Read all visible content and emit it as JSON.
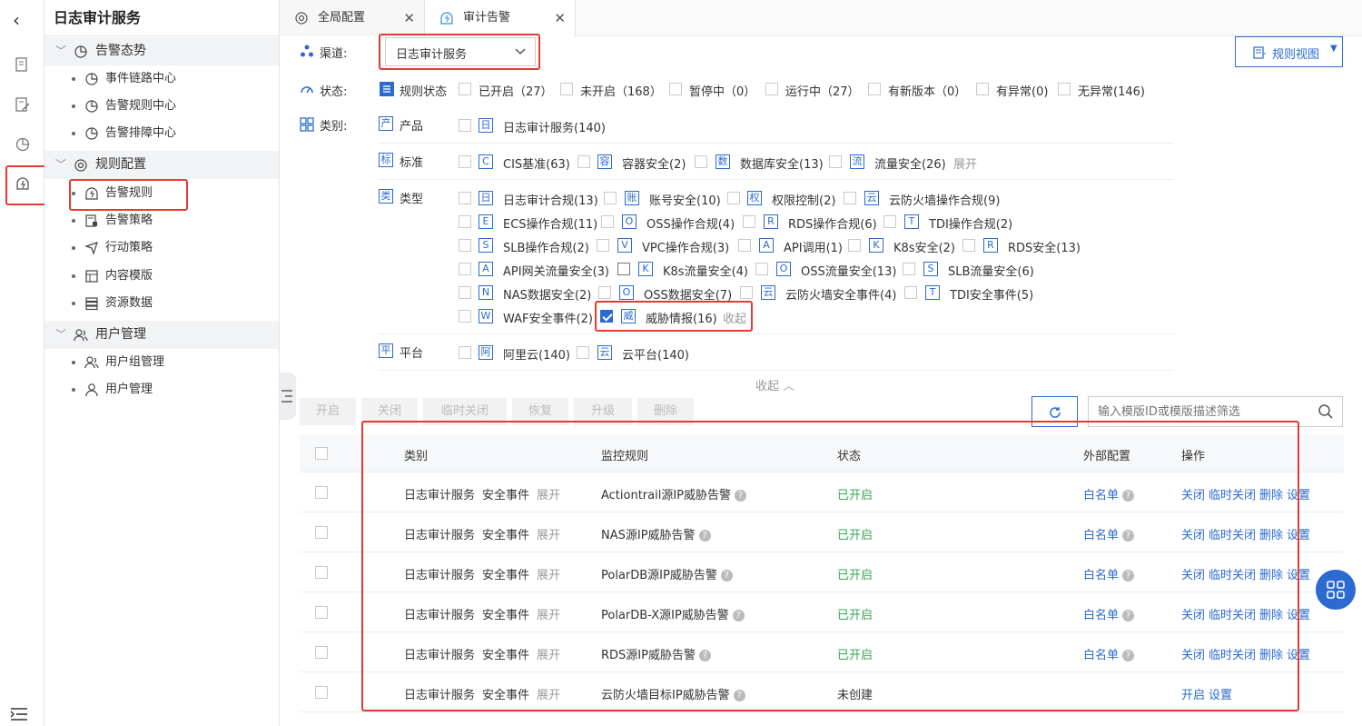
{
  "app_title": "日志审计服务",
  "sidebar": {
    "groups": [
      {
        "label": "告警态势",
        "items": [
          "事件链路中心",
          "告警规则中心",
          "告警排障中心"
        ]
      },
      {
        "label": "规则配置",
        "items": [
          "告警规则",
          "告警策略",
          "行动策略",
          "内容模版",
          "资源数据"
        ]
      },
      {
        "label": "用户管理",
        "items": [
          "用户组管理",
          "用户管理"
        ]
      }
    ]
  },
  "tabs": [
    {
      "label": "全局配置"
    },
    {
      "label": "审计告警"
    }
  ],
  "filters": {
    "channel_label": "渠道:",
    "channel_value": "日志审计服务",
    "rule_view": "规则视图",
    "status_label": "状态:",
    "status_title": "规则状态",
    "status_options": [
      "已开启（27）",
      "未开启（168）",
      "暂停中（0）",
      "运行中（27）",
      "有新版本（0）",
      "有异常(0)",
      "无异常(146)"
    ],
    "category_label": "类别:",
    "product": {
      "badge": "产",
      "label": "产品",
      "items": [
        {
          "b": "日",
          "t": "日志审计服务(140)"
        }
      ]
    },
    "standard": {
      "badge": "标",
      "label": "标准",
      "items": [
        {
          "b": "C",
          "t": "CIS基准(63)"
        },
        {
          "b": "容",
          "t": "容器安全(2)"
        },
        {
          "b": "数",
          "t": "数据库安全(13)"
        },
        {
          "b": "流",
          "t": "流量安全(26)"
        }
      ],
      "more": "展开"
    },
    "type": {
      "badge": "类",
      "label": "类型",
      "rows": [
        [
          {
            "b": "日",
            "t": "日志审计合规(13)"
          },
          {
            "b": "账",
            "t": "账号安全(10)"
          },
          {
            "b": "权",
            "t": "权限控制(2)"
          },
          {
            "b": "云",
            "t": "云防火墙操作合规(9)"
          }
        ],
        [
          {
            "b": "E",
            "t": "ECS操作合规(11)"
          },
          {
            "b": "O",
            "t": "OSS操作合规(4)"
          },
          {
            "b": "R",
            "t": "RDS操作合规(6)"
          },
          {
            "b": "T",
            "t": "TDI操作合规(2)"
          }
        ],
        [
          {
            "b": "S",
            "t": "SLB操作合规(2)"
          },
          {
            "b": "V",
            "t": "VPC操作合规(3)"
          },
          {
            "b": "A",
            "t": "API调用(1)"
          },
          {
            "b": "K",
            "t": "K8s安全(2)"
          },
          {
            "b": "R",
            "t": "RDS安全(13)"
          }
        ],
        [
          {
            "b": "A",
            "t": "API网关流量安全(3)"
          },
          {
            "b": "K",
            "t": "K8s流量安全(4)"
          },
          {
            "b": "O",
            "t": "OSS流量安全(13)"
          },
          {
            "b": "S",
            "t": "SLB流量安全(6)"
          }
        ],
        [
          {
            "b": "N",
            "t": "NAS数据安全(2)"
          },
          {
            "b": "O",
            "t": "OSS数据安全(7)"
          },
          {
            "b": "云",
            "t": "云防火墙安全事件(4)"
          },
          {
            "b": "T",
            "t": "TDI安全事件(5)"
          }
        ],
        [
          {
            "b": "W",
            "t": "WAF安全事件(2)"
          },
          {
            "b": "威",
            "t": "威胁情报(16)"
          }
        ]
      ],
      "collapse": "收起"
    },
    "platform": {
      "badge": "平",
      "label": "平台",
      "items": [
        {
          "b": "阿",
          "t": "阿里云(140)"
        },
        {
          "b": "云",
          "t": "云平台(140)"
        }
      ]
    },
    "collapse_all": "收起"
  },
  "toolbar": {
    "buttons": [
      "开启",
      "关闭",
      "临时关闭",
      "恢复",
      "升级",
      "删除"
    ],
    "search_placeholder": "输入模版ID或模版描述筛选"
  },
  "table": {
    "headers": [
      "类别",
      "监控规则",
      "状态",
      "外部配置",
      "操作"
    ],
    "rows": [
      {
        "cat1": "日志审计服务",
        "cat2": "安全事件",
        "expand": "展开",
        "rule": "Actiontrail源IP威胁告警",
        "status": "已开启",
        "ext": "白名单",
        "ops": [
          "关闭",
          "临时关闭",
          "删除",
          "设置"
        ]
      },
      {
        "cat1": "日志审计服务",
        "cat2": "安全事件",
        "expand": "展开",
        "rule": "NAS源IP威胁告警",
        "status": "已开启",
        "ext": "白名单",
        "ops": [
          "关闭",
          "临时关闭",
          "删除",
          "设置"
        ]
      },
      {
        "cat1": "日志审计服务",
        "cat2": "安全事件",
        "expand": "展开",
        "rule": "PolarDB源IP威胁告警",
        "status": "已开启",
        "ext": "白名单",
        "ops": [
          "关闭",
          "临时关闭",
          "删除",
          "设置"
        ]
      },
      {
        "cat1": "日志审计服务",
        "cat2": "安全事件",
        "expand": "展开",
        "rule": "PolarDB-X源IP威胁告警",
        "status": "已开启",
        "ext": "白名单",
        "ops": [
          "关闭",
          "临时关闭",
          "删除",
          "设置"
        ]
      },
      {
        "cat1": "日志审计服务",
        "cat2": "安全事件",
        "expand": "展开",
        "rule": "RDS源IP威胁告警",
        "status": "已开启",
        "ext": "白名单",
        "ops": [
          "关闭",
          "临时关闭",
          "删除",
          "设置"
        ]
      },
      {
        "cat1": "日志审计服务",
        "cat2": "安全事件",
        "expand": "展开",
        "rule": "云防火墙目标IP威胁告警",
        "status": "未创建",
        "ext": "",
        "ops": [
          "开启",
          "设置"
        ]
      }
    ]
  },
  "colors": {
    "accent": "#2a6ad1",
    "highlight": "#e23b33",
    "enabled": "#35a853"
  }
}
